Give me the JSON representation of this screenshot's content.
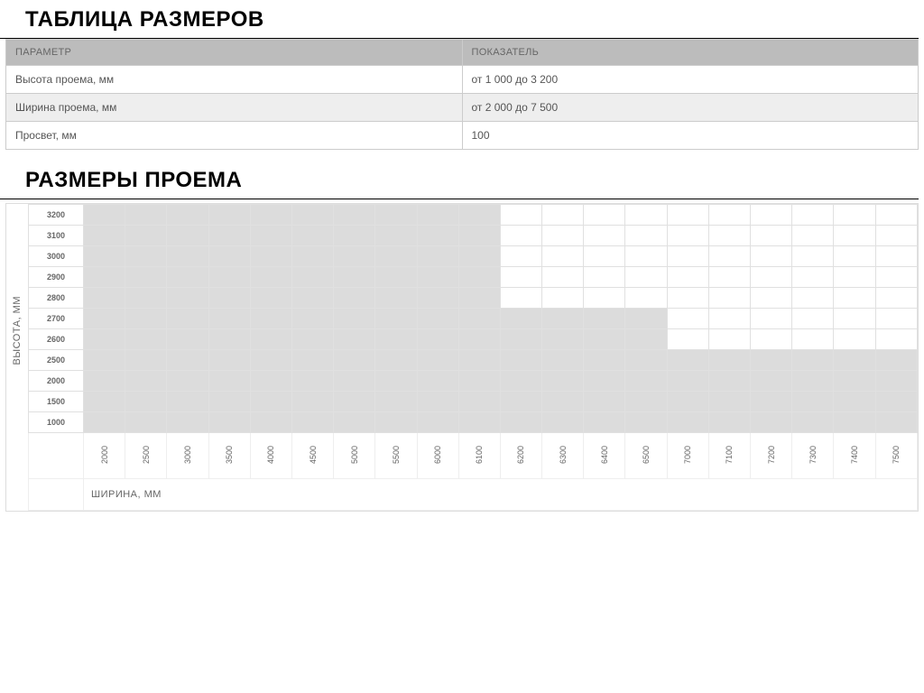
{
  "sections": {
    "sizes_title": "ТАБЛИЦА РАЗМЕРОВ",
    "opening_title": "РАЗМЕРЫ ПРОЕМА"
  },
  "params_table": {
    "headers": {
      "param": "ПАРАМЕТР",
      "value": "ПОКАЗАТЕЛЬ"
    },
    "rows": [
      {
        "param": "Высота проема, мм",
        "value": "от 1 000 до 3 200"
      },
      {
        "param": "Ширина проема, мм",
        "value": "от 2 000 до 7 500"
      },
      {
        "param": "Просвет, мм",
        "value": "100"
      }
    ]
  },
  "chart_data": {
    "type": "heatmap",
    "xlabel": "ШИРИНА, ММ",
    "ylabel": "ВЫСОТА, ММ",
    "x": [
      2000,
      2500,
      3000,
      3500,
      4000,
      4500,
      5000,
      5500,
      6000,
      6100,
      6200,
      6300,
      6400,
      6500,
      7000,
      7100,
      7200,
      7300,
      7400,
      7500
    ],
    "y": [
      3200,
      3100,
      3000,
      2900,
      2800,
      2700,
      2600,
      2500,
      2000,
      1500,
      1000
    ],
    "matrix": [
      [
        1,
        1,
        1,
        1,
        1,
        1,
        1,
        1,
        1,
        1,
        0,
        0,
        0,
        0,
        0,
        0,
        0,
        0,
        0,
        0
      ],
      [
        1,
        1,
        1,
        1,
        1,
        1,
        1,
        1,
        1,
        1,
        0,
        0,
        0,
        0,
        0,
        0,
        0,
        0,
        0,
        0
      ],
      [
        1,
        1,
        1,
        1,
        1,
        1,
        1,
        1,
        1,
        1,
        0,
        0,
        0,
        0,
        0,
        0,
        0,
        0,
        0,
        0
      ],
      [
        1,
        1,
        1,
        1,
        1,
        1,
        1,
        1,
        1,
        1,
        0,
        0,
        0,
        0,
        0,
        0,
        0,
        0,
        0,
        0
      ],
      [
        1,
        1,
        1,
        1,
        1,
        1,
        1,
        1,
        1,
        1,
        0,
        0,
        0,
        0,
        0,
        0,
        0,
        0,
        0,
        0
      ],
      [
        1,
        1,
        1,
        1,
        1,
        1,
        1,
        1,
        1,
        1,
        1,
        1,
        1,
        1,
        0,
        0,
        0,
        0,
        0,
        0
      ],
      [
        1,
        1,
        1,
        1,
        1,
        1,
        1,
        1,
        1,
        1,
        1,
        1,
        1,
        1,
        0,
        0,
        0,
        0,
        0,
        0
      ],
      [
        1,
        1,
        1,
        1,
        1,
        1,
        1,
        1,
        1,
        1,
        1,
        1,
        1,
        1,
        1,
        1,
        1,
        1,
        1,
        1
      ],
      [
        1,
        1,
        1,
        1,
        1,
        1,
        1,
        1,
        1,
        1,
        1,
        1,
        1,
        1,
        1,
        1,
        1,
        1,
        1,
        1
      ],
      [
        1,
        1,
        1,
        1,
        1,
        1,
        1,
        1,
        1,
        1,
        1,
        1,
        1,
        1,
        1,
        1,
        1,
        1,
        1,
        1
      ],
      [
        1,
        1,
        1,
        1,
        1,
        1,
        1,
        1,
        1,
        1,
        1,
        1,
        1,
        1,
        1,
        1,
        1,
        1,
        1,
        1
      ]
    ]
  }
}
